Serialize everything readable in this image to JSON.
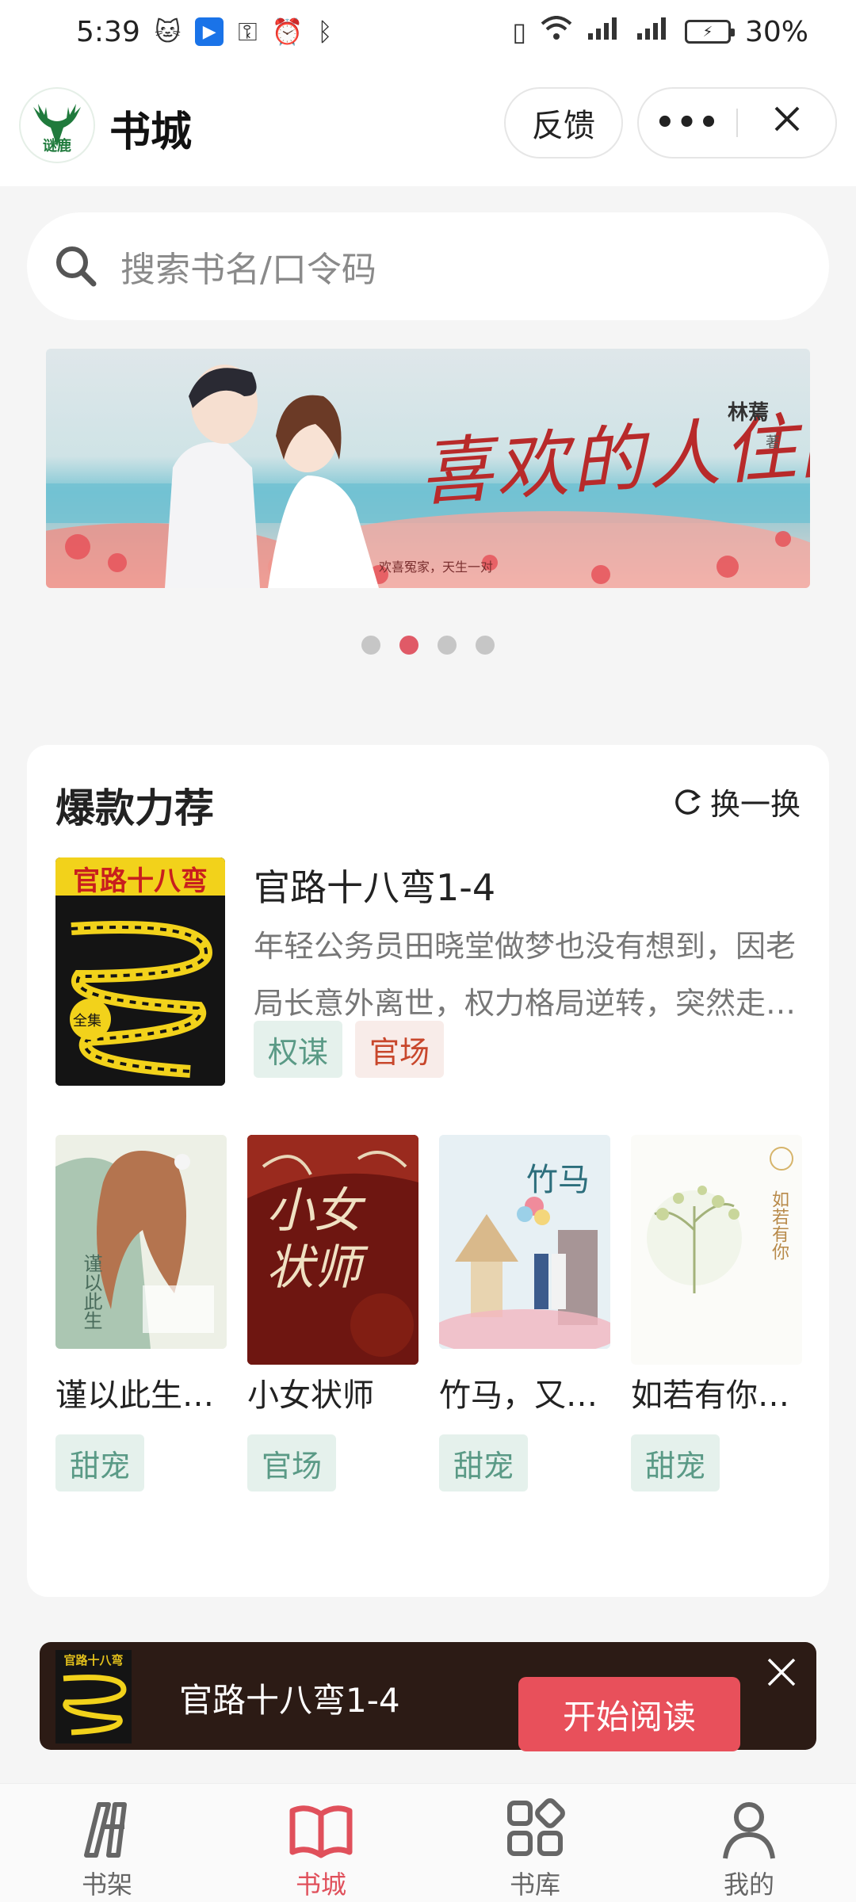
{
  "status_bar": {
    "time": "5:39",
    "battery": "30%"
  },
  "header": {
    "logo_text": "谜鹿",
    "title": "书城",
    "feedback_label": "反馈",
    "more_label": "•••"
  },
  "search": {
    "placeholder": "搜索书名/口令码"
  },
  "banner": {
    "title": "喜欢的人住隔壁",
    "author": "林蔫",
    "author_suffix": "著",
    "tagline": "欢喜冤家，天生一对",
    "active_index": 1,
    "count": 4
  },
  "recommend": {
    "title": "爆款力荐",
    "refresh_label": "换一换",
    "featured": {
      "title": "官路十八弯1-4",
      "cover_text": "官路十八弯",
      "cover_badge": "全集",
      "description": "年轻公务员田晓堂做梦也没有想到，因老局长意外离世，权力格局逆转，突然走…",
      "tags": [
        "权谋",
        "官场"
      ]
    },
    "books": [
      {
        "title": "谨以此生…",
        "cover_text": "谨以此生",
        "tag": "甜宠"
      },
      {
        "title": "小女状师",
        "cover_text": "小女状师",
        "tag": "官场"
      },
      {
        "title": "竹马，又…",
        "cover_text": "竹马",
        "tag": "甜宠"
      },
      {
        "title": "如若有你…",
        "cover_text": "如若有你",
        "tag": "甜宠"
      }
    ]
  },
  "continue_reading": {
    "title": "官路十八弯1-4",
    "button": "开始阅读",
    "cover_text": "官路十八弯"
  },
  "bottom_nav": {
    "items": [
      {
        "label": "书架",
        "icon": "bookshelf-icon"
      },
      {
        "label": "书城",
        "icon": "open-book-icon"
      },
      {
        "label": "书库",
        "icon": "grid-icon"
      },
      {
        "label": "我的",
        "icon": "user-icon"
      }
    ],
    "active_index": 1
  },
  "colors": {
    "accent": "#e0505b",
    "tag_green_bg": "#e5f1ec",
    "tag_green_text": "#5a9a86",
    "tag_red_text": "#c8472c"
  }
}
